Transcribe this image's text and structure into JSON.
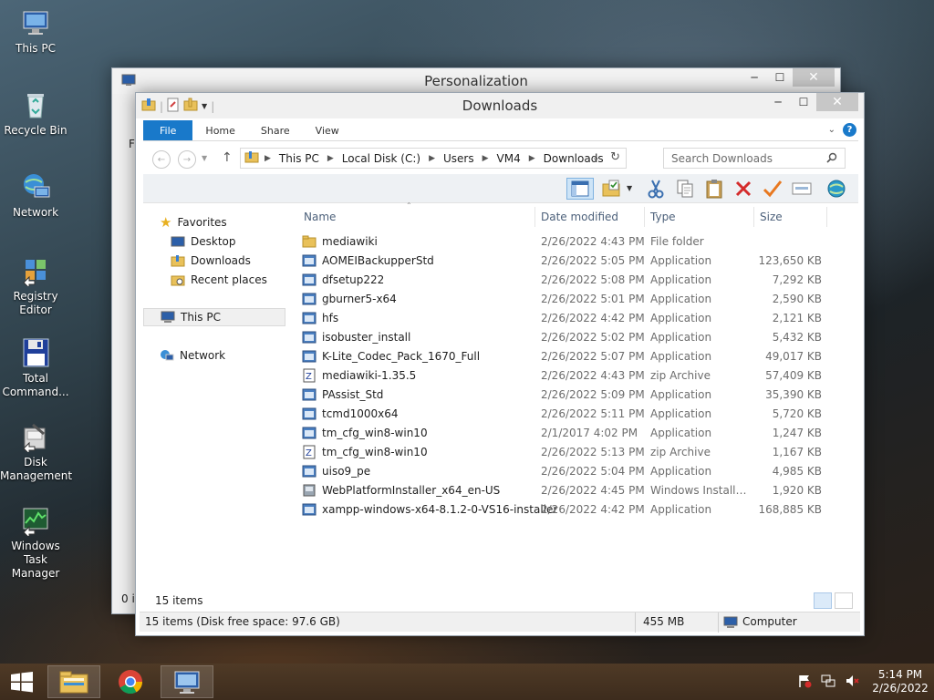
{
  "desktop": {
    "icons": [
      {
        "label": "This PC",
        "icon": "monitor-icon"
      },
      {
        "label": "Recycle Bin",
        "icon": "recycle-bin-icon"
      },
      {
        "label": "Network",
        "icon": "network-icon"
      },
      {
        "label": "Registry Editor",
        "icon": "registry-icon"
      },
      {
        "label": "Total Command...",
        "icon": "floppy-icon"
      },
      {
        "label": "Disk Management",
        "icon": "disk-icon"
      },
      {
        "label": "Windows Task Manager",
        "icon": "task-manager-icon"
      }
    ]
  },
  "bg_window": {
    "title": "Personalization",
    "left_fragment": "Fi",
    "bottom_fragment": "0 it"
  },
  "explorer": {
    "title": "Downloads",
    "ribbon_tabs": [
      "File",
      "Home",
      "Share",
      "View"
    ],
    "breadcrumb": [
      "This PC",
      "Local Disk (C:)",
      "Users",
      "VM4",
      "Downloads"
    ],
    "search_placeholder": "Search Downloads",
    "nav": {
      "favorites": "Favorites",
      "desktop": "Desktop",
      "downloads": "Downloads",
      "recent": "Recent places",
      "this_pc": "This PC",
      "network": "Network"
    },
    "columns": {
      "name": "Name",
      "date": "Date modified",
      "type": "Type",
      "size": "Size"
    },
    "files": [
      {
        "name": "mediawiki",
        "date": "2/26/2022 4:43 PM",
        "type": "File folder",
        "size": "",
        "icon": "folder-icon"
      },
      {
        "name": "AOMEIBackupperStd",
        "date": "2/26/2022 5:05 PM",
        "type": "Application",
        "size": "123,650 KB",
        "icon": "app-icon"
      },
      {
        "name": "dfsetup222",
        "date": "2/26/2022 5:08 PM",
        "type": "Application",
        "size": "7,292 KB",
        "icon": "app-icon"
      },
      {
        "name": "gburner5-x64",
        "date": "2/26/2022 5:01 PM",
        "type": "Application",
        "size": "2,590 KB",
        "icon": "app-icon"
      },
      {
        "name": "hfs",
        "date": "2/26/2022 4:42 PM",
        "type": "Application",
        "size": "2,121 KB",
        "icon": "app-icon"
      },
      {
        "name": "isobuster_install",
        "date": "2/26/2022 5:02 PM",
        "type": "Application",
        "size": "5,432 KB",
        "icon": "app-icon"
      },
      {
        "name": "K-Lite_Codec_Pack_1670_Full",
        "date": "2/26/2022 5:07 PM",
        "type": "Application",
        "size": "49,017 KB",
        "icon": "app-icon"
      },
      {
        "name": "mediawiki-1.35.5",
        "date": "2/26/2022 4:43 PM",
        "type": "zip Archive",
        "size": "57,409 KB",
        "icon": "zip-icon"
      },
      {
        "name": "PAssist_Std",
        "date": "2/26/2022 5:09 PM",
        "type": "Application",
        "size": "35,390 KB",
        "icon": "app-icon"
      },
      {
        "name": "tcmd1000x64",
        "date": "2/26/2022 5:11 PM",
        "type": "Application",
        "size": "5,720 KB",
        "icon": "app-icon"
      },
      {
        "name": "tm_cfg_win8-win10",
        "date": "2/1/2017 4:02 PM",
        "type": "Application",
        "size": "1,247 KB",
        "icon": "app-icon"
      },
      {
        "name": "tm_cfg_win8-win10",
        "date": "2/26/2022 5:13 PM",
        "type": "zip Archive",
        "size": "1,167 KB",
        "icon": "zip-icon"
      },
      {
        "name": "uiso9_pe",
        "date": "2/26/2022 5:04 PM",
        "type": "Application",
        "size": "4,985 KB",
        "icon": "app-icon"
      },
      {
        "name": "WebPlatformInstaller_x64_en-US",
        "date": "2/26/2022 4:45 PM",
        "type": "Windows Installer ...",
        "size": "1,920 KB",
        "icon": "installer-icon"
      },
      {
        "name": "xampp-windows-x64-8.1.2-0-VS16-installer",
        "date": "2/26/2022 4:42 PM",
        "type": "Application",
        "size": "168,885 KB",
        "icon": "app-icon"
      }
    ],
    "item_count": "15 items",
    "status": {
      "left": "15 items (Disk free space: 97.6 GB)",
      "size": "455 MB",
      "location": "Computer"
    }
  },
  "taskbar": {
    "time": "5:14 PM",
    "date": "2/26/2022"
  },
  "colors": {
    "accent": "#1979ca",
    "close_button": "#c7c7c7"
  }
}
